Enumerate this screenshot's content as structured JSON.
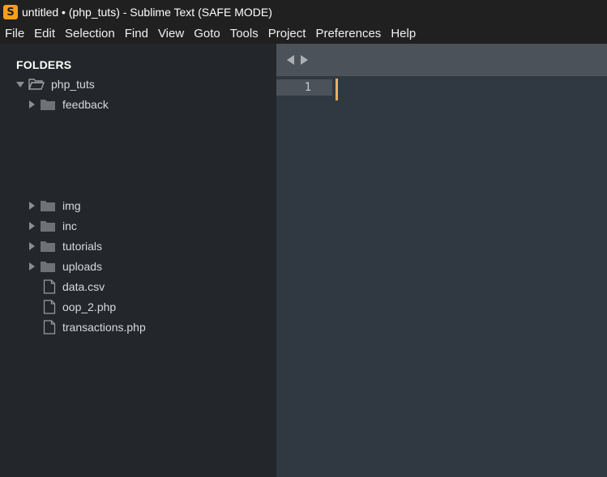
{
  "window": {
    "title": "untitled • (php_tuts) - Sublime Text (SAFE MODE)",
    "app_icon_glyph": "S",
    "app_icon_name": "sublime-text-logo-icon",
    "accent_color": "#f5a019"
  },
  "menu": {
    "items": [
      "File",
      "Edit",
      "Selection",
      "Find",
      "View",
      "Goto",
      "Tools",
      "Project",
      "Preferences",
      "Help"
    ]
  },
  "sidebar": {
    "header": "FOLDERS",
    "root": {
      "name": "php_tuts",
      "expanded": true,
      "icon": "open-folder-icon"
    },
    "items": [
      {
        "name": "feedback",
        "type": "folder",
        "expanded": false
      },
      {
        "name": "img",
        "type": "folder",
        "expanded": false
      },
      {
        "name": "inc",
        "type": "folder",
        "expanded": false
      },
      {
        "name": "tutorials",
        "type": "folder",
        "expanded": false
      },
      {
        "name": "uploads",
        "type": "folder",
        "expanded": false
      },
      {
        "name": "data.csv",
        "type": "file"
      },
      {
        "name": "oop_2.php",
        "type": "file"
      },
      {
        "name": "transactions.php",
        "type": "file"
      }
    ]
  },
  "editor": {
    "line_numbers": [
      "1"
    ],
    "caret_color": "#f9ae58",
    "background_color": "#303841"
  }
}
